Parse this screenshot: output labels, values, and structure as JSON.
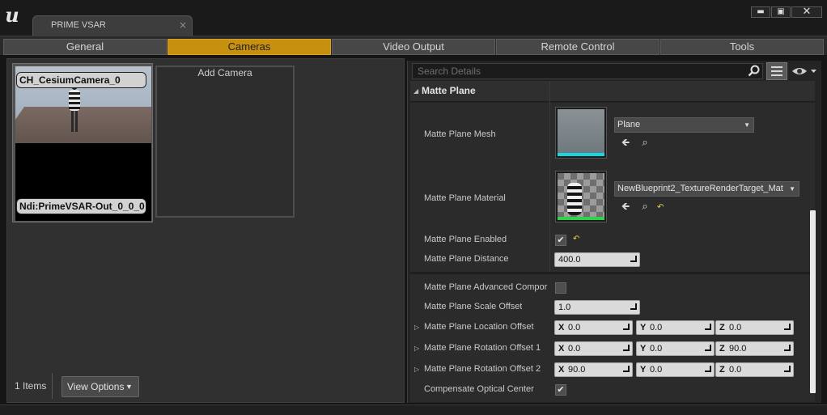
{
  "window": {
    "tab_title": "PRIME VSAR",
    "tab_close": "×",
    "controls": {
      "minimize": "▬",
      "maximize": "▣",
      "close": "✕"
    }
  },
  "tabs": [
    {
      "label": "General",
      "active": false
    },
    {
      "label": "Cameras",
      "active": true
    },
    {
      "label": "Video Output",
      "active": false
    },
    {
      "label": "Remote Control",
      "active": false
    },
    {
      "label": "Tools",
      "active": false
    }
  ],
  "cameras_panel": {
    "camera_tile": {
      "camera_name": "CH_CesiumCamera_0",
      "output_name": "Ndi:PrimeVSAR-Out_0_0_0"
    },
    "add_camera_label": "Add Camera",
    "items_count": "1 Items",
    "view_options_label": "View Options"
  },
  "details_panel": {
    "search": {
      "placeholder": "Search Details"
    },
    "category": "Matte Plane",
    "properties": {
      "mesh": {
        "label": "Matte Plane Mesh",
        "value": "Plane"
      },
      "material": {
        "label": "Matte Plane Material",
        "value": "NewBlueprint2_TextureRenderTarget_Mat"
      },
      "enabled": {
        "label": "Matte Plane Enabled",
        "checked": true
      },
      "distance": {
        "label": "Matte Plane Distance",
        "value": "400.0"
      },
      "advanced": {
        "label": "Matte Plane Advanced Compor",
        "checked": false
      },
      "scale_offset": {
        "label": "Matte Plane Scale Offset",
        "value": "1.0"
      },
      "location_offset": {
        "label": "Matte Plane Location Offset",
        "x": "0.0",
        "y": "0.0",
        "z": "0.0"
      },
      "rotation_offset_1": {
        "label": "Matte Plane Rotation Offset 1",
        "x": "0.0",
        "y": "0.0",
        "z": "90.0"
      },
      "rotation_offset_2": {
        "label": "Matte Plane Rotation Offset 2",
        "x": "90.0",
        "y": "0.0",
        "z": "0.0"
      },
      "compensate": {
        "label": "Compensate Optical Center",
        "checked": true
      }
    },
    "axis_labels": {
      "x": "X",
      "y": "Y",
      "z": "Z"
    }
  },
  "colors": {
    "accent_active_tab": "#c8900f",
    "panel_bg": "#2b2b2b",
    "reset_arrow": "#e6d54a"
  },
  "icons": [
    "unreal-logo-icon",
    "search-icon",
    "grid-view-icon",
    "eye-icon",
    "use-selected-arrow-icon",
    "browse-icon",
    "reset-to-default-icon",
    "checkmark-icon",
    "expand-triangle-icon",
    "dropdown-arrow-icon"
  ]
}
